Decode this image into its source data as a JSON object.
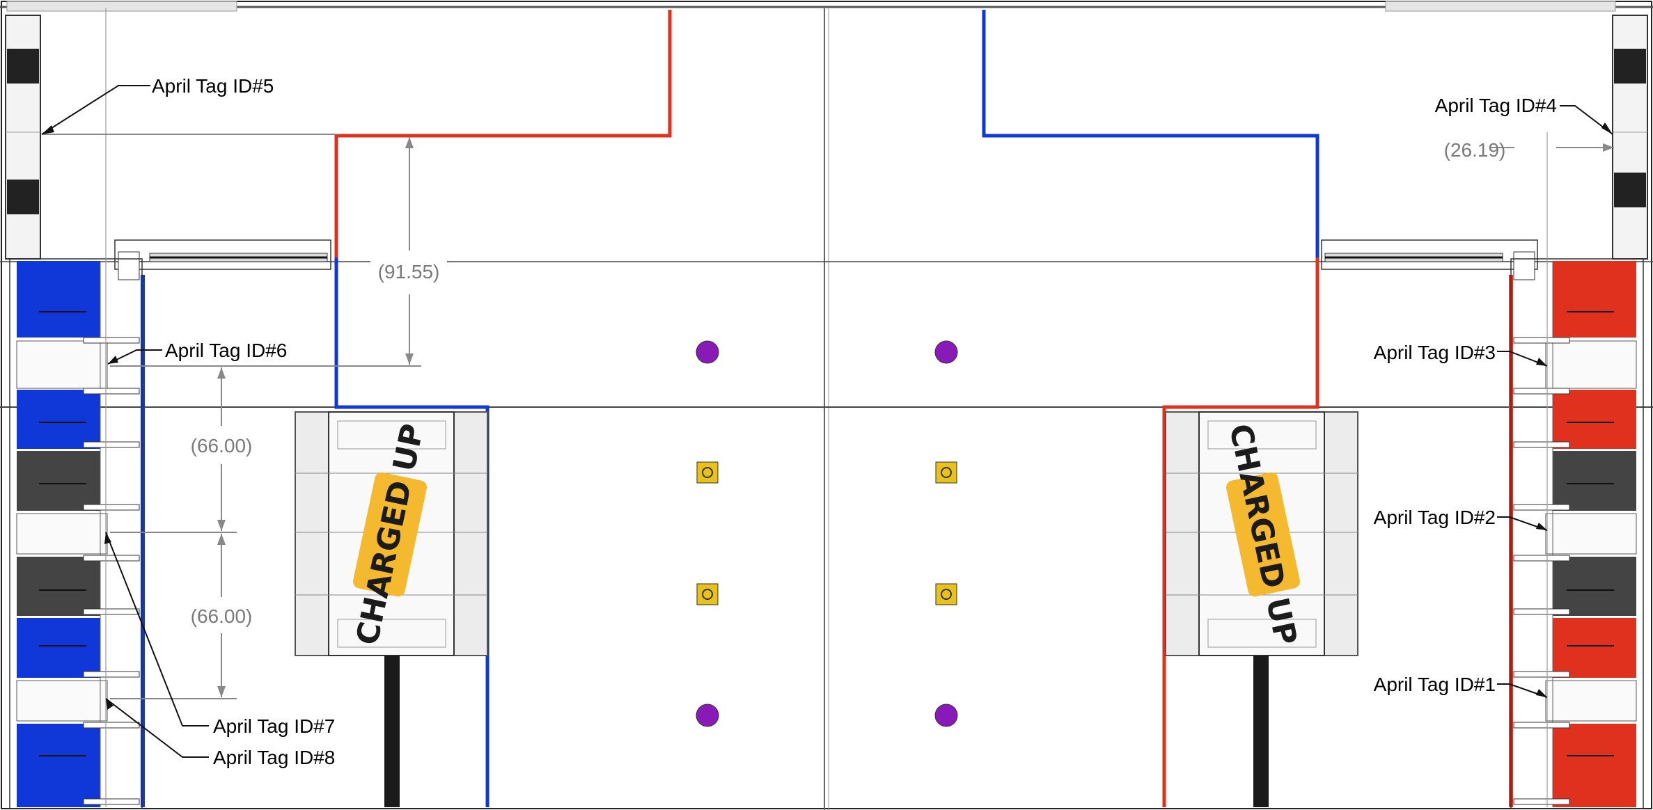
{
  "april_tags": [
    {
      "id": "tag-5",
      "label": "April Tag ID#5"
    },
    {
      "id": "tag-4",
      "label": "April Tag ID#4"
    },
    {
      "id": "tag-6",
      "label": "April Tag ID#6"
    },
    {
      "id": "tag-3",
      "label": "April Tag ID#3"
    },
    {
      "id": "tag-2",
      "label": "April Tag ID#2"
    },
    {
      "id": "tag-7",
      "label": "April Tag ID#7"
    },
    {
      "id": "tag-8",
      "label": "April Tag ID#8"
    },
    {
      "id": "tag-1",
      "label": "April Tag ID#1"
    }
  ],
  "dimensions": {
    "d1": "(91.55)",
    "d2": "(66.00)",
    "d3": "(66.00)",
    "d4": "(26.19)"
  },
  "logo": {
    "text": "CHARGED UP",
    "color": "#f5b930"
  },
  "colors": {
    "blue_alliance": "#1038d8",
    "red_alliance": "#e0301e",
    "game_piece_cube": "#8a1ab8",
    "game_piece_cone": "#e8c21a",
    "dark_node": "#444444"
  }
}
